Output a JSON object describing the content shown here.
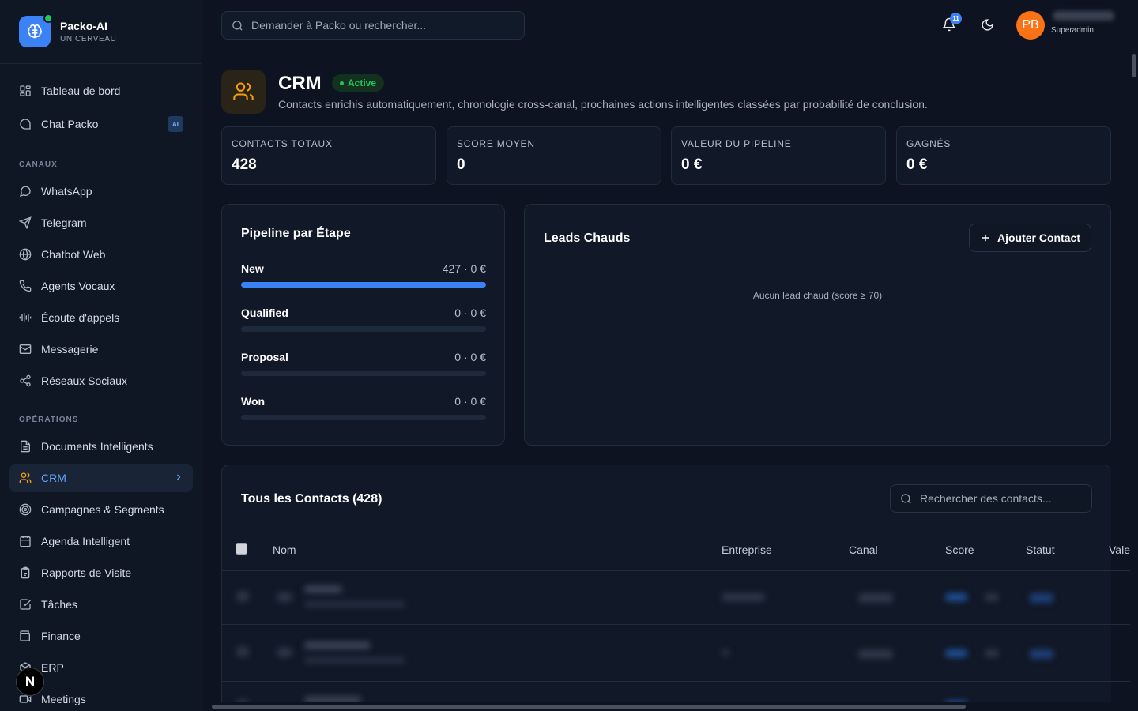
{
  "brand": {
    "name": "Packo-AI",
    "subtitle": "UN CERVEAU"
  },
  "sidebar": {
    "top_items": [
      {
        "label": "Tableau de bord",
        "icon": "dashboard-icon"
      },
      {
        "label": "Chat Packo",
        "icon": "chat-icon",
        "badge": "AI"
      }
    ],
    "sections": [
      {
        "title": "CANAUX",
        "items": [
          {
            "label": "WhatsApp",
            "icon": "message-circle-icon"
          },
          {
            "label": "Telegram",
            "icon": "send-icon"
          },
          {
            "label": "Chatbot Web",
            "icon": "globe-icon"
          },
          {
            "label": "Agents Vocaux",
            "icon": "phone-icon"
          },
          {
            "label": "Écoute d'appels",
            "icon": "audio-wave-icon"
          },
          {
            "label": "Messagerie",
            "icon": "mail-icon"
          },
          {
            "label": "Réseaux Sociaux",
            "icon": "share-icon"
          }
        ]
      },
      {
        "title": "OPÉRATIONS",
        "items": [
          {
            "label": "Documents Intelligents",
            "icon": "document-icon"
          },
          {
            "label": "CRM",
            "icon": "users-icon",
            "active": true
          },
          {
            "label": "Campagnes & Segments",
            "icon": "target-icon"
          },
          {
            "label": "Agenda Intelligent",
            "icon": "calendar-icon"
          },
          {
            "label": "Rapports de Visite",
            "icon": "clipboard-icon"
          },
          {
            "label": "Tâches",
            "icon": "check-square-icon"
          },
          {
            "label": "Finance",
            "icon": "wallet-icon"
          },
          {
            "label": "ERP",
            "icon": "box-icon"
          },
          {
            "label": "Meetings",
            "icon": "video-icon"
          }
        ]
      }
    ],
    "floating_badge": "N"
  },
  "topbar": {
    "search_placeholder": "Demander à Packo ou rechercher...",
    "notification_count": "11",
    "avatar_initials": "PB",
    "user_role": "Superadmin"
  },
  "module": {
    "title": "CRM",
    "status": "Active",
    "description": "Contacts enrichis automatiquement, chronologie cross-canal, prochaines actions intelligentes classées par probabilité de conclusion."
  },
  "stats": [
    {
      "label": "CONTACTS TOTAUX",
      "value": "428"
    },
    {
      "label": "SCORE MOYEN",
      "value": "0"
    },
    {
      "label": "VALEUR DU PIPELINE",
      "value": "0 €"
    },
    {
      "label": "GAGNÉS",
      "value": "0 €"
    }
  ],
  "pipeline": {
    "title": "Pipeline par Étape",
    "stages": [
      {
        "name": "New",
        "value": "427 · 0 €",
        "fill": 1.0
      },
      {
        "name": "Qualified",
        "value": "0 · 0 €",
        "fill": 0
      },
      {
        "name": "Proposal",
        "value": "0 · 0 €",
        "fill": 0
      },
      {
        "name": "Won",
        "value": "0 · 0 €",
        "fill": 0
      }
    ]
  },
  "hot_leads": {
    "title": "Leads Chauds",
    "add_button": "Ajouter Contact",
    "empty": "Aucun lead chaud (score ≥ 70)"
  },
  "contacts": {
    "title": "Tous les Contacts (428)",
    "search_placeholder": "Rechercher des contacts...",
    "columns": [
      "Nom",
      "Entreprise",
      "Canal",
      "Score",
      "Statut",
      "Vale"
    ]
  },
  "colors": {
    "accent": "#3b82f6",
    "crm_icon": "#f59e0b",
    "active_badge": "#22c55e",
    "avatar": "#f97316"
  }
}
